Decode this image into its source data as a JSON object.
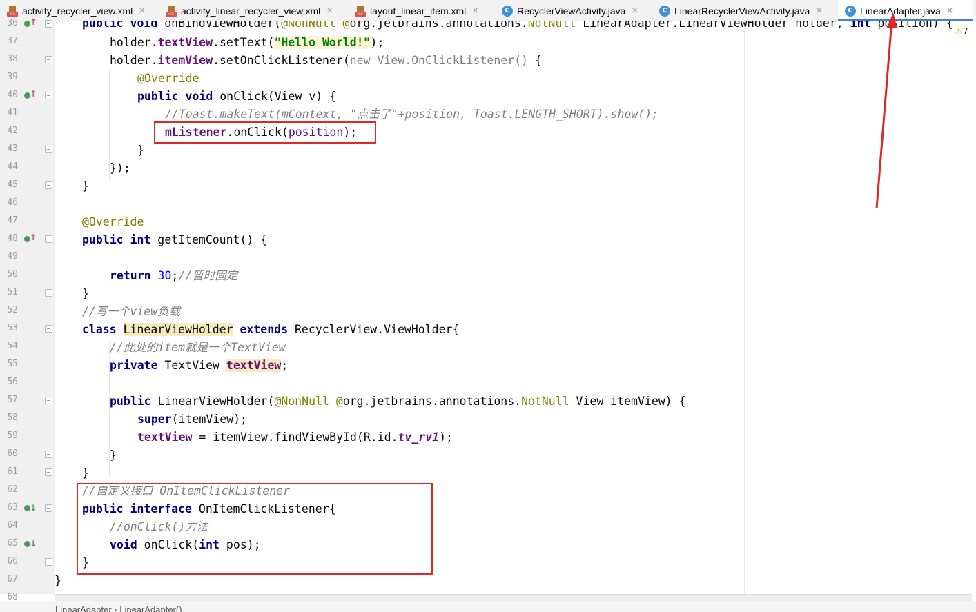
{
  "tabs": [
    {
      "label": "activity_recycler_view.xml",
      "icon": "xml-file-icon"
    },
    {
      "label": "activity_linear_recycler_view.xml",
      "icon": "xml-file-icon"
    },
    {
      "label": "layout_linear_item.xml",
      "icon": "xml-file-icon"
    },
    {
      "label": "RecyclerViewActivity.java",
      "icon": "java-class-icon"
    },
    {
      "label": "LinearRecyclerViewActivity.java",
      "icon": "java-class-icon"
    },
    {
      "label": "LinearAdapter.java",
      "icon": "java-class-icon",
      "active": true
    }
  ],
  "tab_close_glyph": "×",
  "java_icon_letter": "C",
  "xml_icon_text": "<>",
  "warning_count": "7",
  "line_numbers": [
    "36",
    "37",
    "38",
    "39",
    "40",
    "41",
    "42",
    "43",
    "44",
    "45",
    "46",
    "47",
    "48",
    "49",
    "50",
    "51",
    "52",
    "53",
    "54",
    "55",
    "56",
    "57",
    "58",
    "59",
    "60",
    "61",
    "62",
    "63",
    "64",
    "65",
    "66",
    "67",
    "68"
  ],
  "code": {
    "l36": {
      "kw1": "public void ",
      "t1": "onBindViewHolder(",
      "a1": "@NonNull ",
      "a2": "@",
      "t2": "org.jetbrains.annotations.",
      "a3": "NotNull ",
      "t3": "LinearAdapter.LinearViewHolder holder, ",
      "kw2": "int ",
      "t4": "position) {"
    },
    "l37": {
      "t1": "holder.",
      "f1": "textView",
      "t2": ".setText(",
      "s1": "\"Hello World!\"",
      "t3": ");"
    },
    "l38": {
      "t1": "holder.",
      "f1": "itemView",
      "t2": ".setOnClickListener(",
      "g1": "new View.OnClickListener()",
      "t3": " {"
    },
    "l39": {
      "a1": "@Override"
    },
    "l40": {
      "kw1": "public void ",
      "t1": "onClick(View v) {"
    },
    "l41": {
      "c1": "//Toast.makeText(mContext, \"点击了\"+position, Toast.LENGTH_SHORT).show();"
    },
    "l42": {
      "f1": "mListener",
      "t1": ".onClick(",
      "p1": "position",
      "t2": ");"
    },
    "l43": {
      "t1": "}"
    },
    "l44": {
      "t1": "});"
    },
    "l45": {
      "t1": "}"
    },
    "l47": {
      "a1": "@Override"
    },
    "l48": {
      "kw1": "public int ",
      "t1": "getItemCount() {"
    },
    "l50": {
      "kw1": "return ",
      "n1": "30",
      "t1": ";",
      "c1": "//暂时固定"
    },
    "l51": {
      "t1": "}"
    },
    "l52": {
      "c1": "//写一个view负载"
    },
    "l53": {
      "kw1": "class ",
      "h1": "LinearViewHolder",
      "t1": " ",
      "kw2": "extends ",
      "t2": "RecyclerView.ViewHolder{"
    },
    "l54": {
      "c1": "//此处的item就是一个TextView"
    },
    "l55": {
      "kw1": "private ",
      "t1": "TextView ",
      "f1": "textView",
      "t2": ";"
    },
    "l57": {
      "kw1": "public ",
      "t1": "LinearViewHolder(",
      "a1": "@NonNull ",
      "a2": "@",
      "t2": "org.jetbrains.annotations.",
      "a3": "NotNull ",
      "t3": "View itemView) {"
    },
    "l58": {
      "kw1": "super",
      "t1": "(itemView);"
    },
    "l59": {
      "f1": "textView",
      "t1": " = itemView.findViewById(R.id.",
      "fi1": "tv_rv1",
      "t2": ");"
    },
    "l60": {
      "t1": "}"
    },
    "l61": {
      "t1": "}"
    },
    "l62": {
      "c1": "//自定义接口 OnItemClickListener"
    },
    "l63": {
      "kw1": "public interface ",
      "t1": "OnItemClickListener{"
    },
    "l64": {
      "c1": "//onClick()方法"
    },
    "l65": {
      "kw1": "void ",
      "t1": "onClick(",
      "kw2": "int ",
      "t2": "pos);"
    },
    "l66": {
      "t1": "}"
    },
    "l67": {
      "t1": "}"
    }
  },
  "breadcrumb": "LinearAdapter  ›  LinearAdapter()",
  "colors": {
    "annotation_red": "#e02727",
    "keyword": "#000080",
    "field": "#660e7a",
    "string": "#008000",
    "comment": "#808080",
    "active_tab_underline": "#4083c9"
  }
}
